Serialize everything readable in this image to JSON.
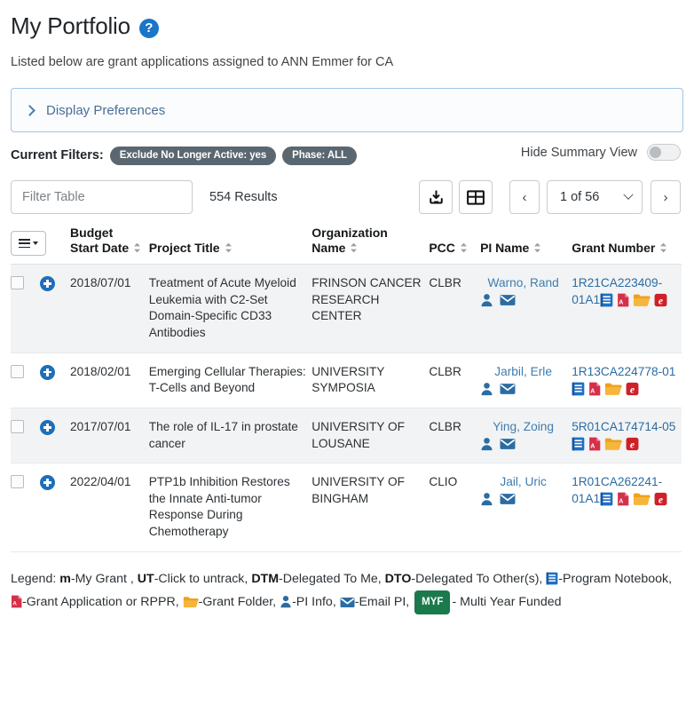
{
  "header": {
    "title": "My Portfolio",
    "help_icon": "question-mark-circle-icon",
    "subtitle": "Listed below are grant applications assigned to ANN Emmer for CA"
  },
  "display_preferences": {
    "label": "Display Preferences",
    "expand_icon": "chevron-right-icon",
    "expanded": false
  },
  "current_filters": {
    "label": "Current Filters:",
    "pills": [
      "Exclude No Longer Active: yes",
      "Phase: ALL"
    ]
  },
  "hide_summary_view": {
    "label": "Hide Summary View",
    "enabled": false
  },
  "toolbar": {
    "filter_placeholder": "Filter Table",
    "filter_value": "",
    "results_text": "554 Results",
    "export_icon": "download-icon",
    "grid_icon": "table-grid-icon",
    "prev_label": "‹",
    "next_label": "›",
    "page_text": "1 of 56"
  },
  "table": {
    "menu_icon": "hamburger-menu-icon",
    "columns": [
      {
        "label": "Budget Start Date",
        "sortable": true
      },
      {
        "label": "Project Title",
        "sortable": true
      },
      {
        "label": "Organization Name",
        "sortable": true
      },
      {
        "label": "PCC",
        "sortable": true
      },
      {
        "label": "PI Name",
        "sortable": true
      },
      {
        "label": "Grant Number",
        "sortable": true
      }
    ],
    "rows": [
      {
        "selected": false,
        "budget_start_date": "2018/07/01",
        "project_title": "Treatment of Acute Myeloid Leukemia with C2-Set Domain-Specific CD33 Antibodies",
        "organization_name": "FRINSON CANCER RESEARCH CENTER",
        "pcc": "CLBR",
        "pi_name": "Warno, Rand",
        "grant_number": "1R21CA223409-01A1",
        "doc_icons": [
          "program-notebook-icon",
          "pdf-icon",
          "folder-icon",
          "era-commons-icon"
        ],
        "pi_icons": [
          "pi-info-icon",
          "email-pi-icon"
        ]
      },
      {
        "selected": false,
        "budget_start_date": "2018/02/01",
        "project_title": "Emerging Cellular Therapies: T-Cells and Beyond",
        "organization_name": "UNIVERSITY SYMPOSIA",
        "pcc": "CLBR",
        "pi_name": "Jarbil, Erle",
        "grant_number": "1R13CA224778-01",
        "doc_icons": [
          "program-notebook-icon",
          "pdf-icon",
          "folder-icon",
          "era-commons-icon"
        ],
        "pi_icons": [
          "pi-info-icon",
          "email-pi-icon"
        ]
      },
      {
        "selected": false,
        "budget_start_date": "2017/07/01",
        "project_title": "The role of IL-17 in prostate cancer",
        "organization_name": "UNIVERSITY OF LOUSANE",
        "pcc": "CLBR",
        "pi_name": "Ying, Zoing",
        "grant_number": "5R01CA174714-05",
        "doc_icons": [
          "program-notebook-icon",
          "pdf-icon",
          "folder-icon",
          "era-commons-icon"
        ],
        "pi_icons": [
          "pi-info-icon",
          "email-pi-icon"
        ]
      },
      {
        "selected": false,
        "budget_start_date": "2022/04/01",
        "project_title": "PTP1b Inhibition Restores the Innate Anti-tumor Response During Chemotherapy",
        "organization_name": "UNIVERSITY OF BINGHAM",
        "pcc": "CLIO",
        "pi_name": "Jail, Uric",
        "grant_number": "1R01CA262241-01A1",
        "doc_icons": [
          "program-notebook-icon",
          "pdf-icon",
          "folder-icon",
          "era-commons-icon"
        ],
        "pi_icons": [
          "pi-info-icon",
          "email-pi-icon"
        ]
      }
    ]
  },
  "legend": {
    "prefix": "Legend:",
    "items": [
      {
        "key": "m",
        "desc": "-My Grant ,"
      },
      {
        "key": "UT",
        "desc": "-Click to untrack,"
      },
      {
        "key": "DTM",
        "desc": "-Delegated To Me,"
      },
      {
        "key": "DTO",
        "desc": "-Delegated To Other(s),"
      }
    ],
    "program_notebook": "-Program Notebook,",
    "grant_application": "-Grant Application or RPPR,",
    "grant_folder": "-Grant Folder,",
    "pi_info": "-PI Info,",
    "email_pi": "-Email PI,",
    "myf_badge": "MYF",
    "myf_desc": "- Multi Year Funded"
  },
  "colors": {
    "accent_blue": "#1d6fb8",
    "link_blue": "#2b6ca3",
    "pill_gray": "#5b6770",
    "panel_border": "#9fc4e4",
    "folder_orange": "#f0a01e",
    "pdf_red": "#d5304a",
    "era_red": "#cf2027",
    "myf_green": "#1b7a4b"
  }
}
